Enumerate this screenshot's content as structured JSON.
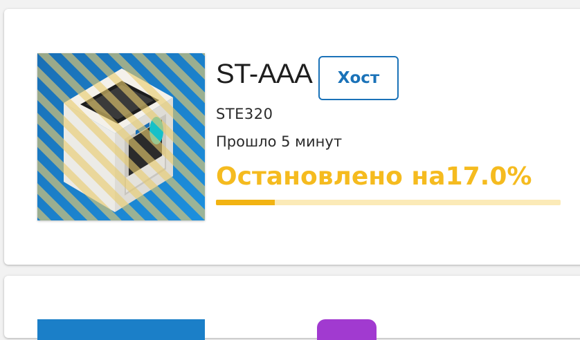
{
  "printer": {
    "name": "ST-AAA",
    "role_label": "Хост",
    "model": "STE320",
    "elapsed": "Прошло 5 минут",
    "status_text": "Остановлено на",
    "status_percent": "17.0%",
    "progress": 0.17,
    "image_icon": "3d-printer-image"
  },
  "colors": {
    "accent_blue": "#1a72b8",
    "status_yellow": "#f5bb1f",
    "progress_fill": "#f2b312",
    "progress_track": "#fbeab7",
    "second_card_badge": "#a13ad0"
  }
}
